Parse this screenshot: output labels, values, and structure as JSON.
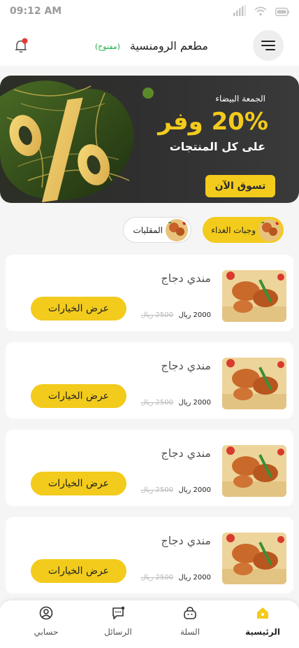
{
  "status_bar": {
    "time": "09:12 AM"
  },
  "header": {
    "store_name": "مطعم الرومنسية",
    "store_status": "(مفتوح)"
  },
  "banner": {
    "subtitle": "الجمعة البيضاء",
    "headline": "20% وفر",
    "line": "على كل المنتجات",
    "cta": "تسوق الآن",
    "accent_color": "#f2cb1c"
  },
  "categories": [
    {
      "label": "وجبات الغداء",
      "active": true
    },
    {
      "label": "المقليات",
      "active": false
    }
  ],
  "products": [
    {
      "name": "مندي دجاج",
      "price": "2000 ريال",
      "old_price": "2500 ريال",
      "button": "عرض الخيارات"
    },
    {
      "name": "مندي دجاج",
      "price": "2000 ريال",
      "old_price": "2500 ريال",
      "button": "عرض الخيارات"
    },
    {
      "name": "مندي دجاج",
      "price": "2000 ريال",
      "old_price": "2500 ريال",
      "button": "عرض الخيارات"
    },
    {
      "name": "مندي دجاج",
      "price": "2000 ريال",
      "old_price": "2500 ريال",
      "button": "عرض الخيارات"
    }
  ],
  "bottom_nav": [
    {
      "label": "الرئيسية",
      "icon": "home-icon",
      "active": true
    },
    {
      "label": "السلة",
      "icon": "basket-icon",
      "active": false
    },
    {
      "label": "الرسائل",
      "icon": "messages-icon",
      "active": false
    },
    {
      "label": "حسابي",
      "icon": "profile-icon",
      "active": false
    }
  ]
}
